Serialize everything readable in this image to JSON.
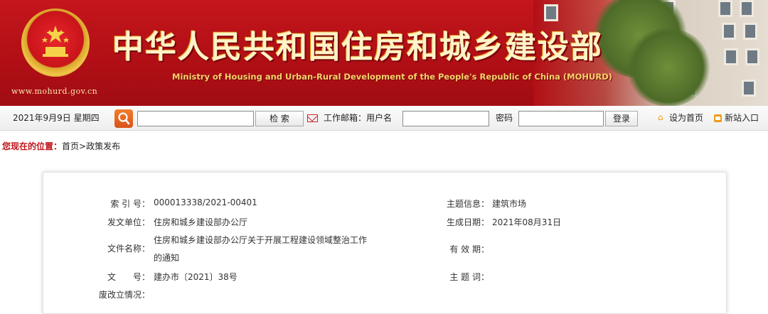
{
  "header": {
    "site_url": "www.mohurd.gov.cn",
    "title_cn": "中华人民共和国住房和城乡建设部",
    "title_en": "Ministry of Housing and Urban-Rural Development of the People's Republic of China (MOHURD)"
  },
  "toolbar": {
    "date": "2021年9月9日 星期四",
    "search_placeholder": "",
    "search_button": "检 索",
    "mail_label": "工作邮箱：用户名",
    "username_value": "",
    "password_label": "密码",
    "password_value": "",
    "login_button": "登录",
    "set_home": "设为首页",
    "new_site": "新站入口"
  },
  "breadcrumb": {
    "here_label": "您现在的位置：",
    "path": "首页>政策发布"
  },
  "doc_info": {
    "index_label": "索 引 号：",
    "index_value": "000013338/2021-00401",
    "topic_label": "主题信息：",
    "topic_value": "建筑市场",
    "issuer_label": "发文单位：",
    "issuer_value": "住房和城乡建设部办公厅",
    "date_label": "生成日期：",
    "date_value": "2021年08月31日",
    "filename_label": "文件名称：",
    "filename_line1": "住房和城乡建设部办公厅关于开展工程建设领域整治工作",
    "filename_line2": "的通知",
    "validity_label": "有 效 期：",
    "docno_label": "文　　号：",
    "docno_value": "建办市〔2021〕38号",
    "keywords_label": "主 题 词：",
    "status_label": "废改立情况："
  },
  "colors": {
    "banner_red": "#c4161c",
    "title_gold": "#fff3c8",
    "breadcrumb_red": "#c0141b",
    "search_orange": "#e0621f"
  }
}
